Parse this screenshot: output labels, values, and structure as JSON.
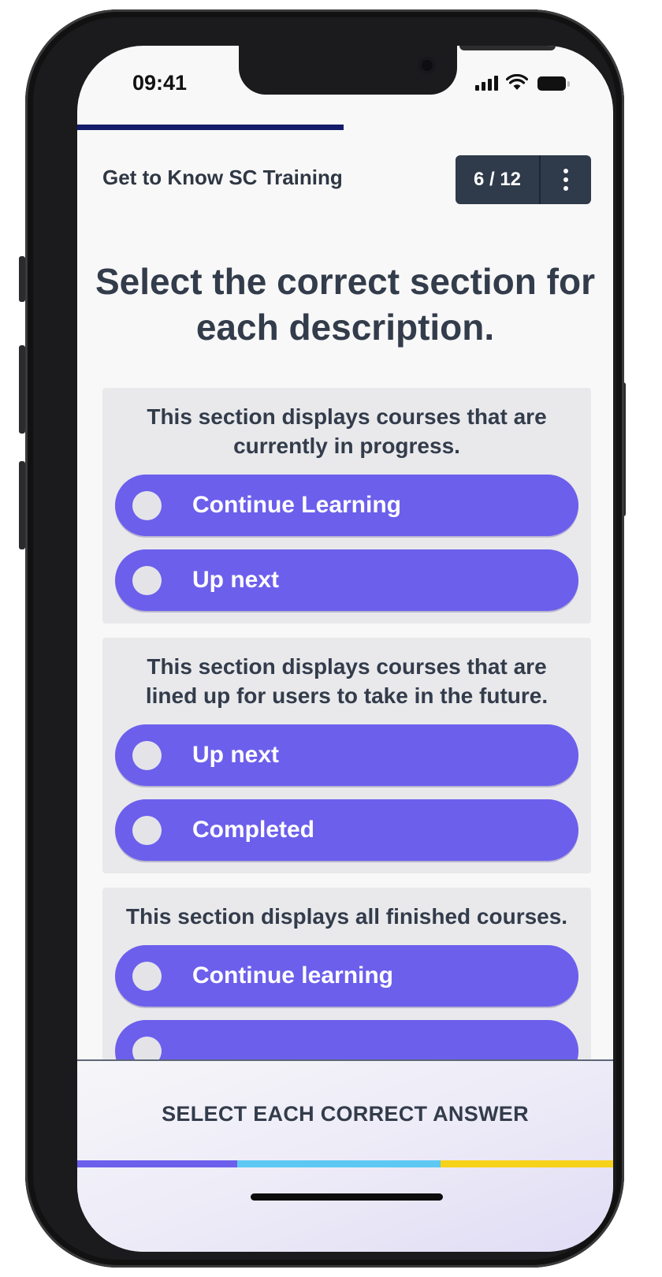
{
  "status_bar": {
    "time": "09:41"
  },
  "header": {
    "course_title": "Get to Know SC Training",
    "counter": "6 / 12"
  },
  "question": {
    "text": "Select the correct section for each description."
  },
  "cards": [
    {
      "prompt": "This section displays courses that are currently in progress.",
      "options": [
        {
          "label": "Continue Learning"
        },
        {
          "label": "Up next"
        }
      ]
    },
    {
      "prompt": "This section displays courses that are lined up for users to take in the future.",
      "options": [
        {
          "label": "Up next"
        },
        {
          "label": "Completed"
        }
      ]
    },
    {
      "prompt": "This section displays all finished courses.",
      "options": [
        {
          "label": "Continue learning"
        },
        {
          "label": ""
        }
      ]
    }
  ],
  "footer": {
    "instruction": "SELECT EACH CORRECT ANSWER"
  },
  "colors": {
    "accent": "#6c5fec",
    "progress": "#131c6a",
    "bar_purple": "#6c5fec",
    "bar_blue": "#5ec8f2",
    "bar_yellow": "#f7d21b"
  },
  "icons": {
    "menu": "vertical-dots-icon",
    "signal": "signal-icon",
    "wifi": "wifi-icon",
    "battery": "battery-icon"
  }
}
